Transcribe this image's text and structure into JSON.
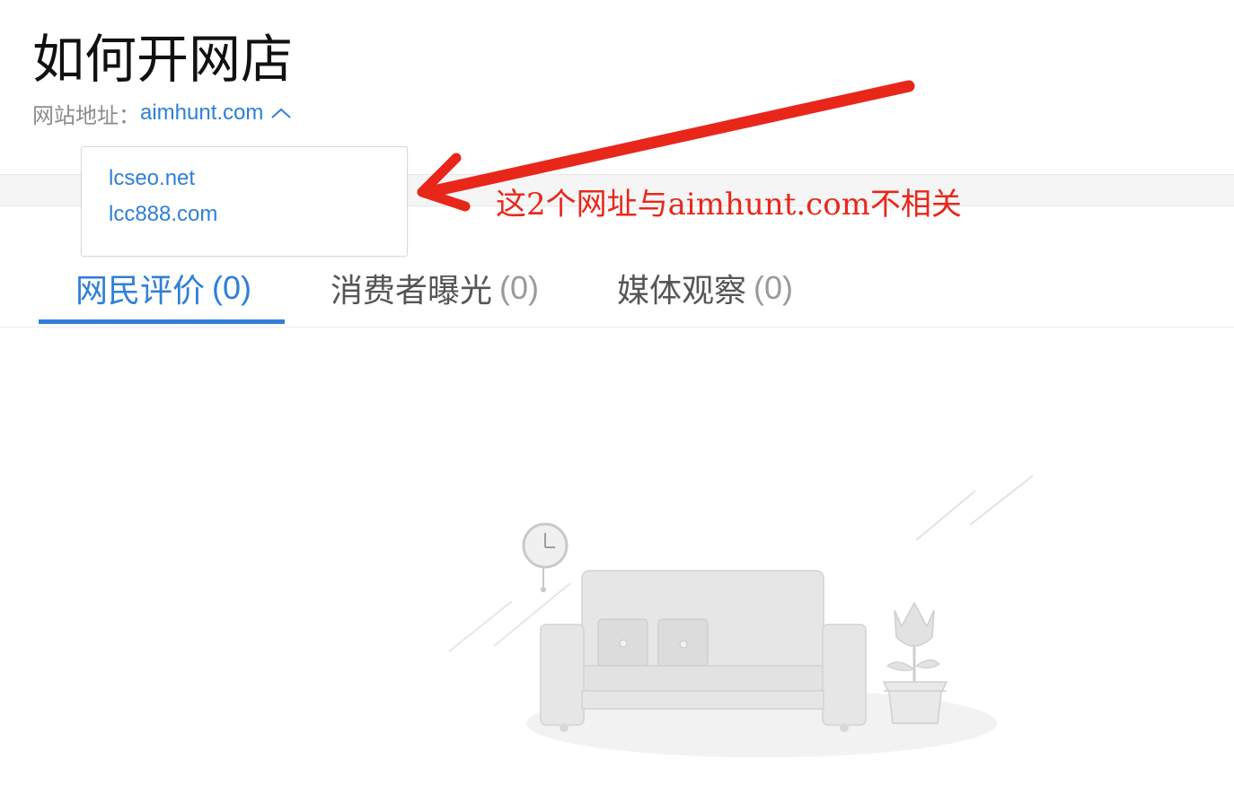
{
  "page": {
    "title": "如何开网店"
  },
  "site": {
    "label": "网站地址：",
    "url": "aimhunt.com",
    "expanded_icon": "chevron-up-icon"
  },
  "dropdown": {
    "items": [
      {
        "label": "lcseo.net"
      },
      {
        "label": "lcc888.com"
      }
    ]
  },
  "tabs": [
    {
      "label": "网民评价",
      "count": "(0)",
      "active": true
    },
    {
      "label": "消费者曝光",
      "count": "(0)",
      "active": false
    },
    {
      "label": "媒体观察",
      "count": "(0)",
      "active": false
    }
  ],
  "annotation": {
    "text": "这2个网址与aimhunt.com不相关",
    "color": "#e8271a",
    "icon": "arrow-icon"
  },
  "empty_state": {
    "illustration": "empty-room-sofa-icon"
  },
  "colors": {
    "accent": "#2f7fd8",
    "annotation": "#e8271a"
  }
}
